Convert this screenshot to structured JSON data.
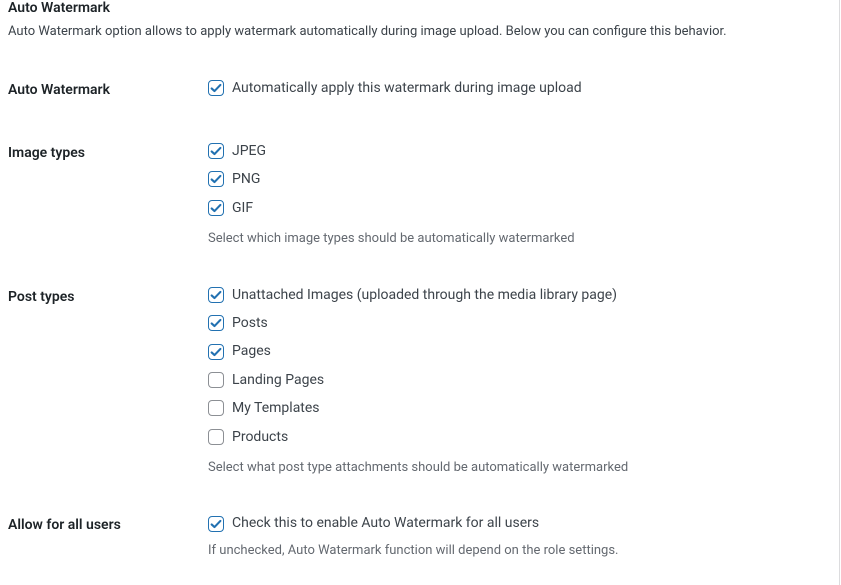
{
  "header": {
    "title": "Auto Watermark",
    "description": "Auto Watermark option allows to apply watermark automatically during image upload. Below you can configure this behavior."
  },
  "rows": {
    "auto_watermark": {
      "th": "Auto Watermark",
      "option": {
        "label": "Automatically apply this watermark during image upload",
        "checked": true
      }
    },
    "image_types": {
      "th": "Image types",
      "options": [
        {
          "label": "JPEG",
          "checked": true
        },
        {
          "label": "PNG",
          "checked": true
        },
        {
          "label": "GIF",
          "checked": true
        }
      ],
      "help": "Select which image types should be automatically watermarked"
    },
    "post_types": {
      "th": "Post types",
      "options": [
        {
          "label": "Unattached Images (uploaded through the media library page)",
          "checked": true
        },
        {
          "label": "Posts",
          "checked": true
        },
        {
          "label": "Pages",
          "checked": true
        },
        {
          "label": "Landing Pages",
          "checked": false
        },
        {
          "label": "My Templates",
          "checked": false
        },
        {
          "label": "Products",
          "checked": false
        }
      ],
      "help": "Select what post type attachments should be automatically watermarked"
    },
    "allow_all_users": {
      "th": "Allow for all users",
      "option": {
        "label": "Check this to enable Auto Watermark for all users",
        "checked": true
      },
      "help": "If unchecked, Auto Watermark function will depend on the role settings."
    }
  }
}
